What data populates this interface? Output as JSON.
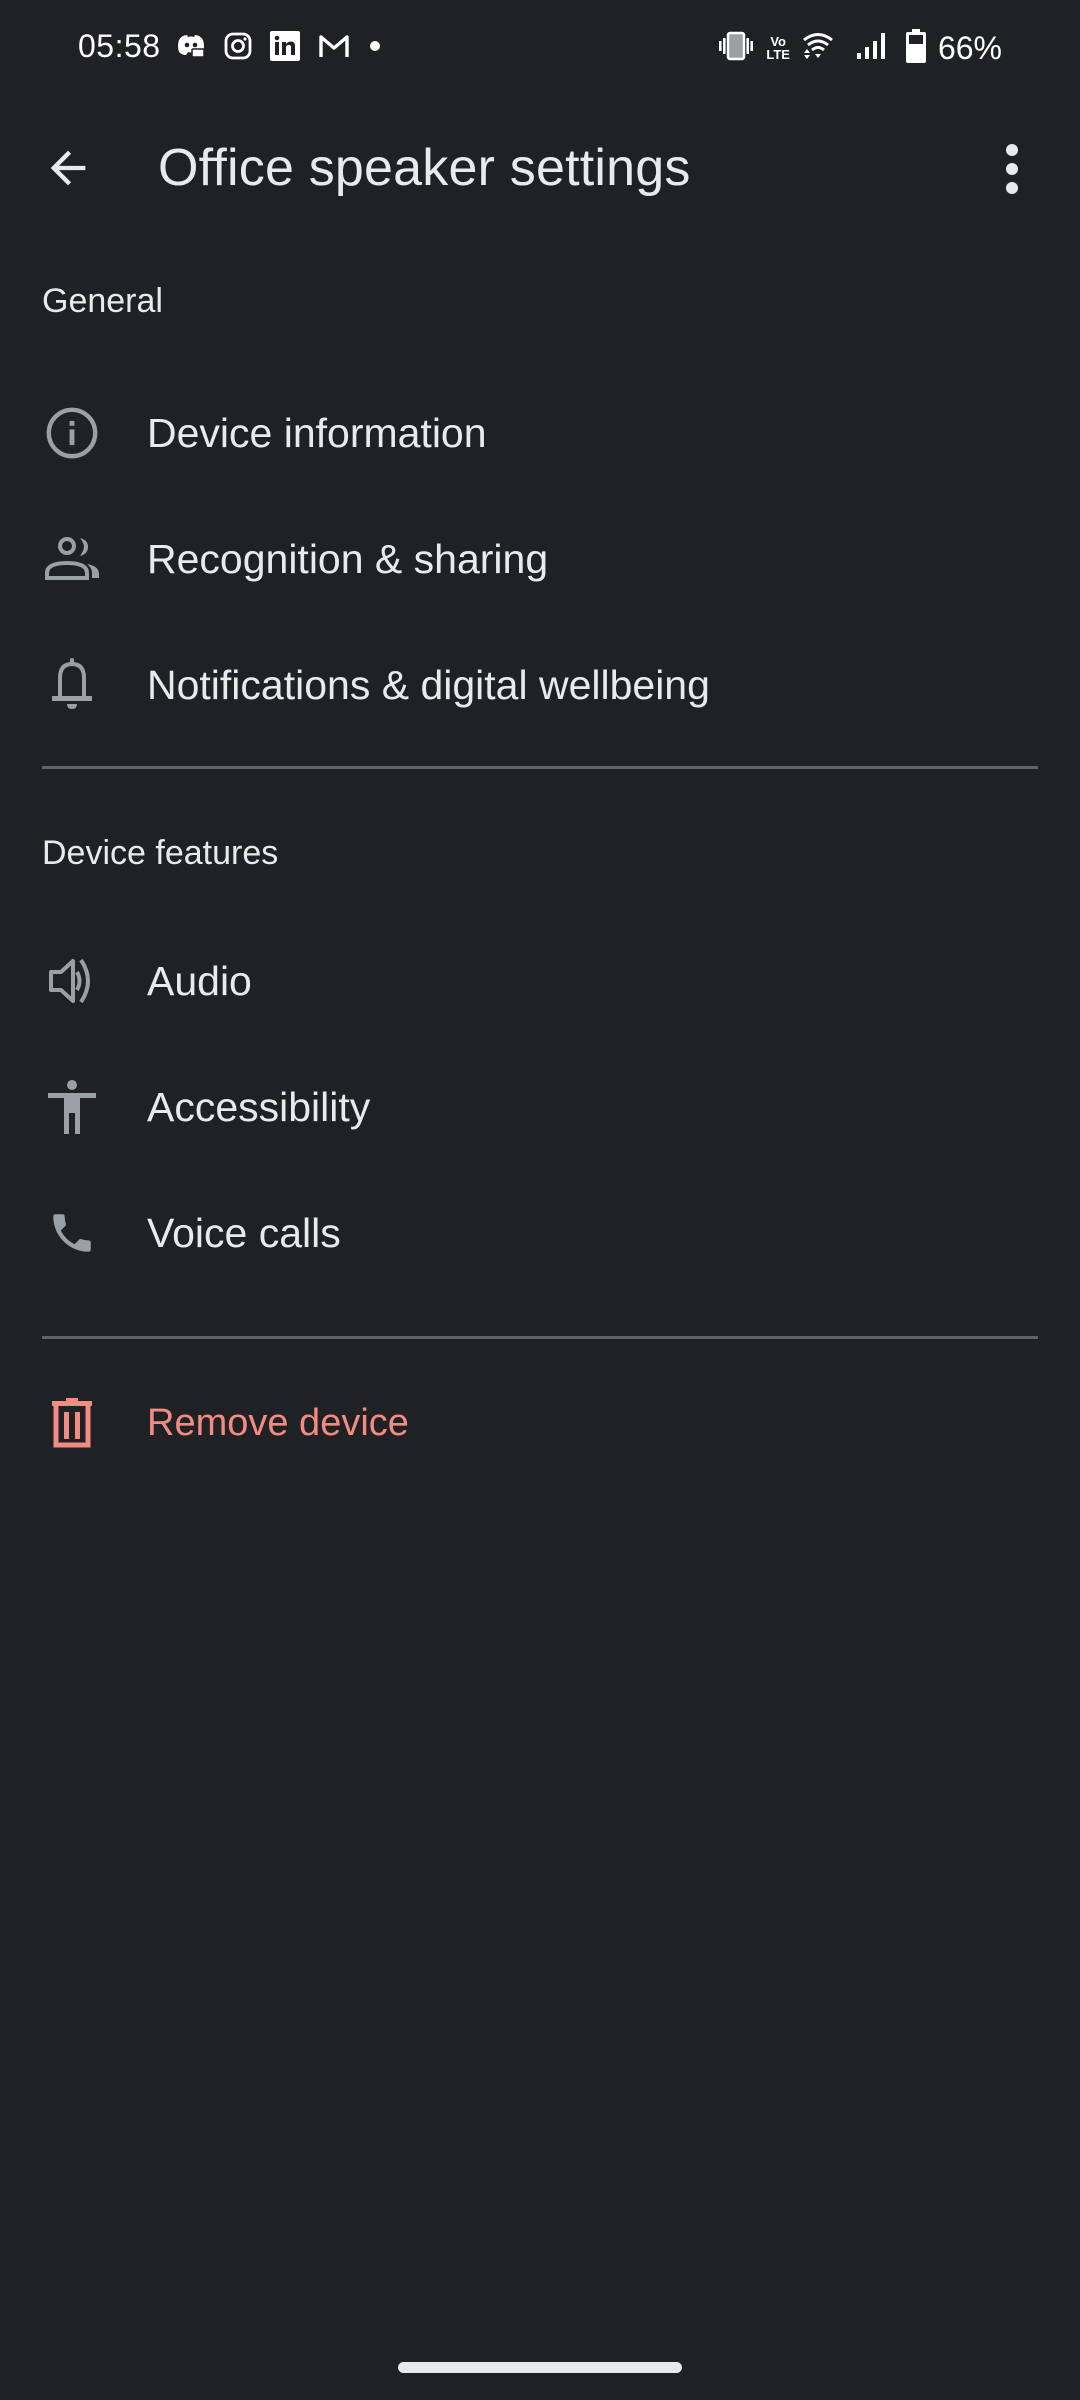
{
  "status_bar": {
    "time": "05:58",
    "notification_icons": [
      "discord-icon",
      "instagram-icon",
      "linkedin-icon",
      "gmail-icon",
      "more-notifications-dot"
    ],
    "system_icons": [
      "vibrate-icon",
      "volte-icon",
      "wifi-icon",
      "cellular-signal-icon",
      "battery-icon"
    ],
    "volte_label_top": "Vo",
    "volte_label_bottom": "LTE",
    "battery_percent": "66%",
    "battery_level": 0.66
  },
  "app_bar": {
    "back_icon": "arrow-back-icon",
    "title": "Office speaker settings",
    "more_icon": "more-vert-icon"
  },
  "sections": [
    {
      "header": "General",
      "items": [
        {
          "label": "Device information",
          "icon": "info-icon"
        },
        {
          "label": "Recognition & sharing",
          "icon": "people-icon"
        },
        {
          "label": "Notifications & digital wellbeing",
          "icon": "bell-icon"
        }
      ]
    },
    {
      "header": "Device features",
      "items": [
        {
          "label": "Audio",
          "icon": "speaker-icon"
        },
        {
          "label": "Accessibility",
          "icon": "accessibility-icon"
        },
        {
          "label": "Voice calls",
          "icon": "phone-icon"
        }
      ]
    }
  ],
  "remove_device": {
    "label": "Remove device",
    "icon": "trash-icon"
  },
  "colors": {
    "background": "#202124",
    "text": "#e8eaed",
    "icon": "#9aa0a6",
    "divider": "#5f6368",
    "danger": "#f28b82"
  }
}
